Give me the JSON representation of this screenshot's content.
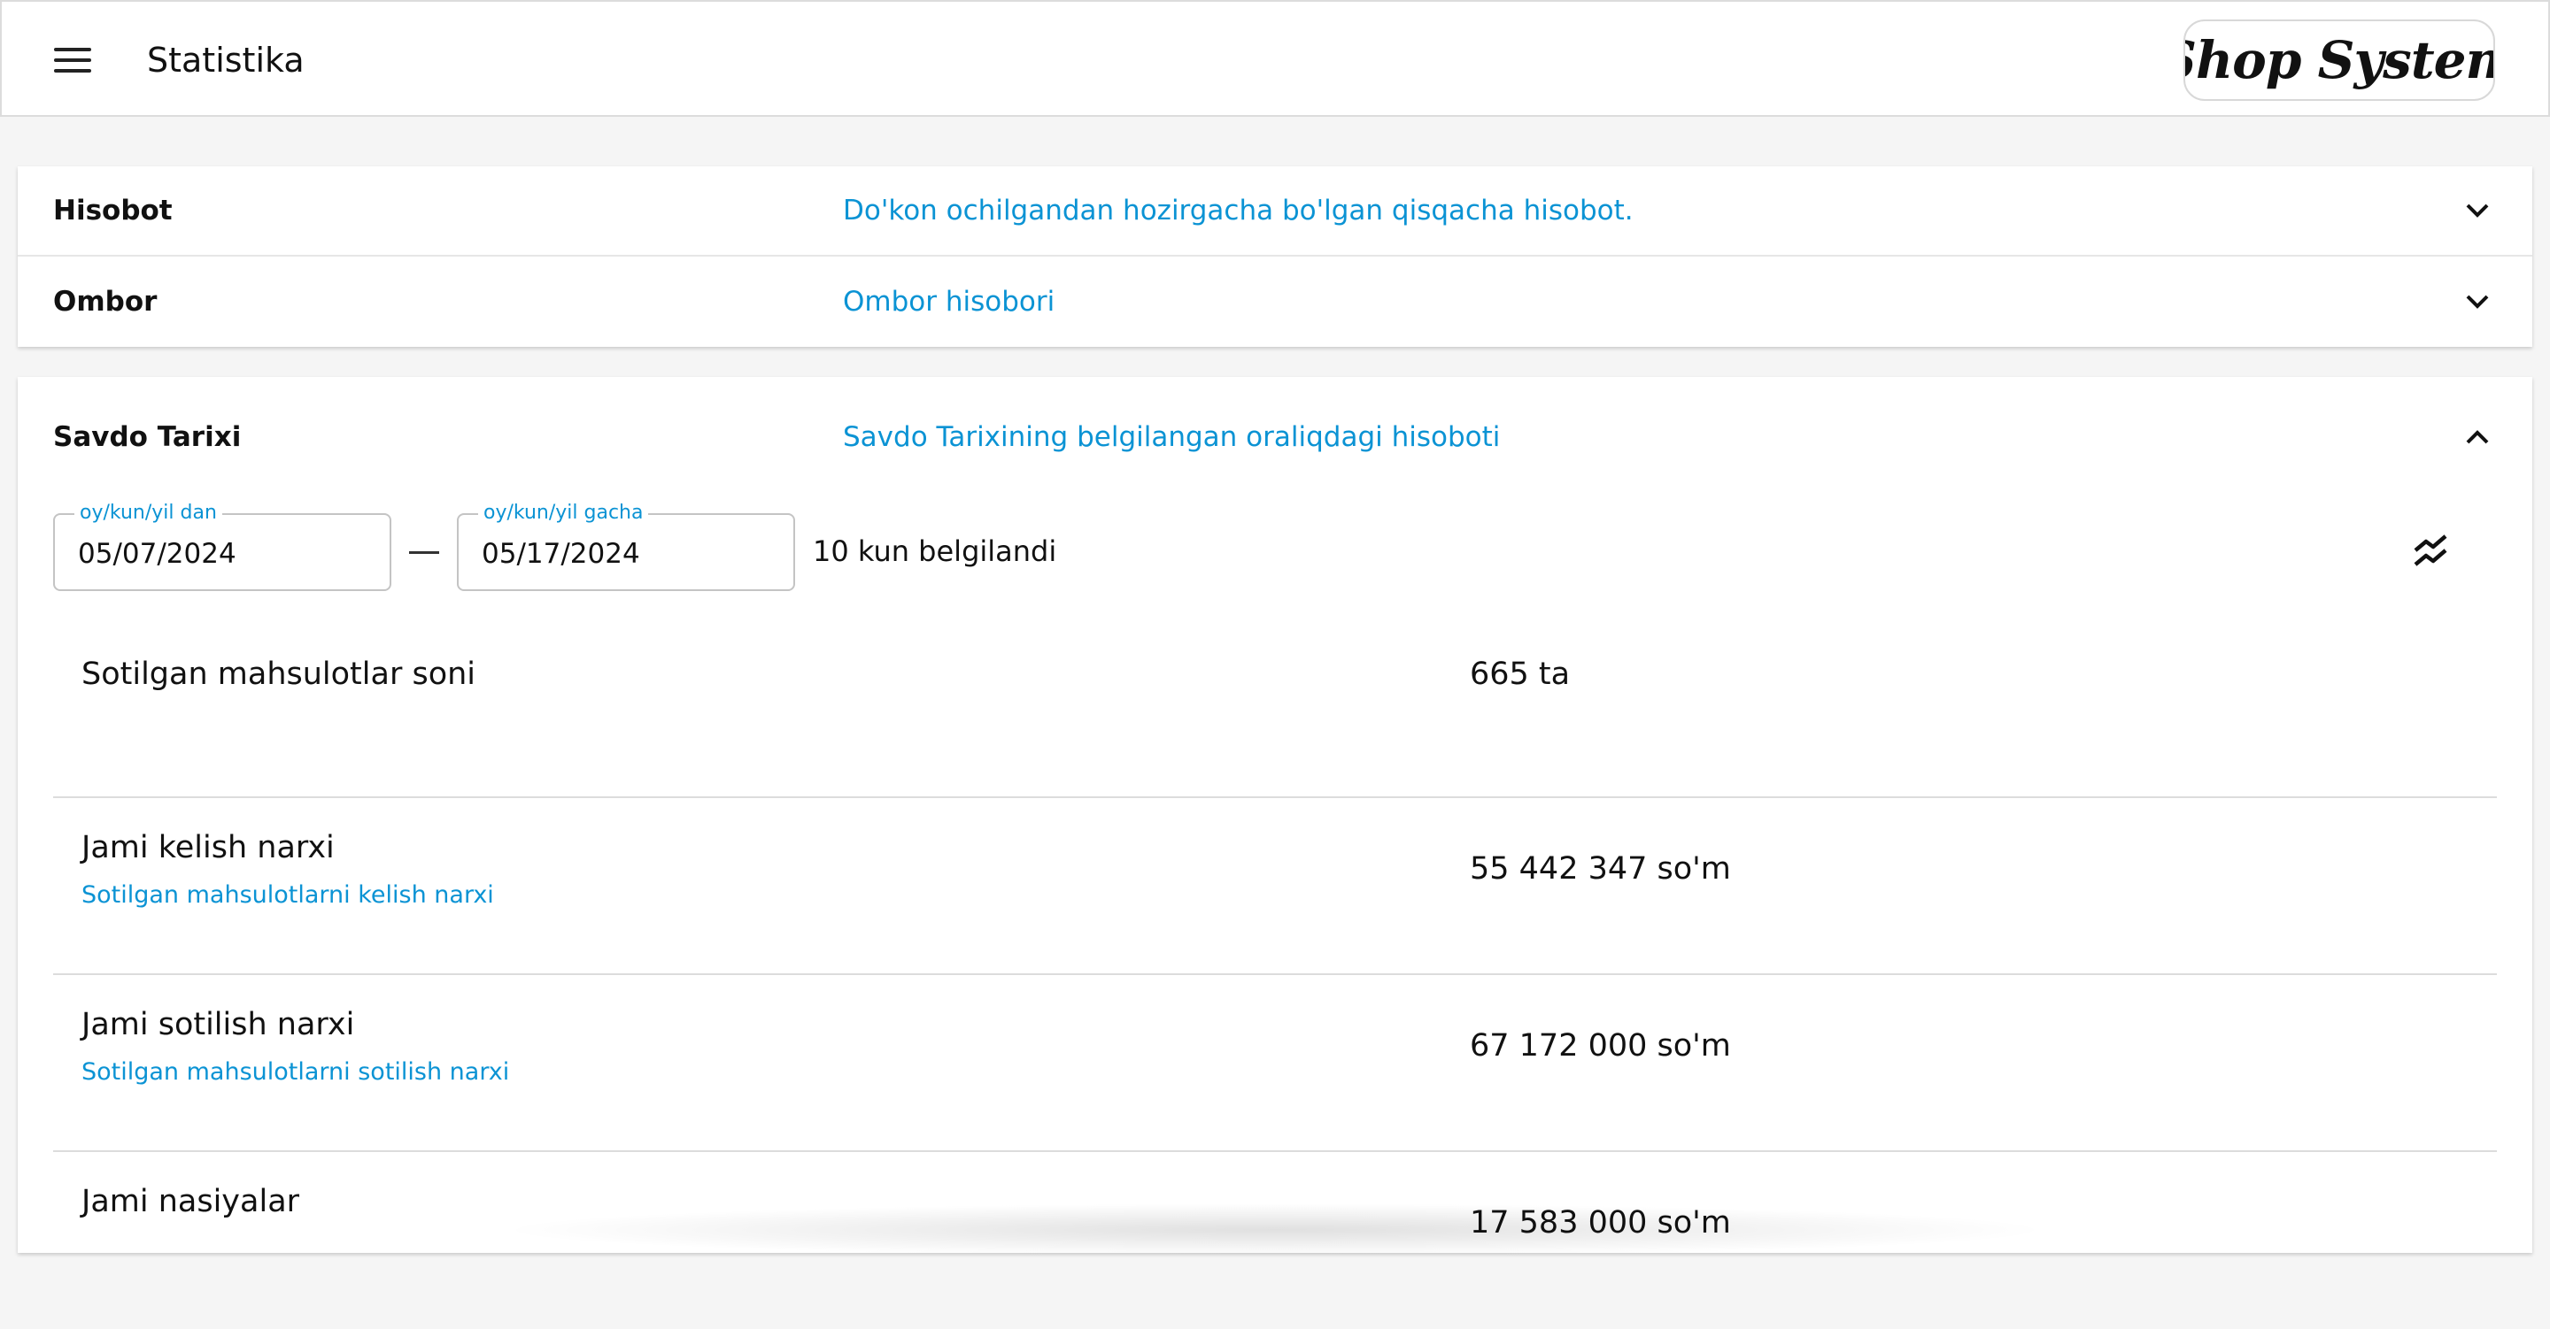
{
  "header": {
    "title": "Statistika",
    "logo_text": "Shop System"
  },
  "panels": [
    {
      "title": "Hisobot",
      "description": "Do'kon ochilgandan hozirgacha bo'lgan qisqacha hisobot."
    },
    {
      "title": "Ombor",
      "description": "Ombor hisobori"
    }
  ],
  "sales_history": {
    "title": "Savdo Tarixi",
    "description": "Savdo Tarixining belgilangan oraliqdagi hisoboti",
    "date_from": {
      "label": "oy/kun/yil dan",
      "value": "05/07/2024"
    },
    "date_to": {
      "label": "oy/kun/yil gacha",
      "value": "05/17/2024"
    },
    "range_note": "10 kun belgilandi",
    "stats": [
      {
        "label": "Sotilgan mahsulotlar soni",
        "sub": "",
        "value": "665 ta"
      },
      {
        "label": "Jami kelish narxi",
        "sub": "Sotilgan mahsulotlarni kelish narxi",
        "value": "55 442 347 so'm"
      },
      {
        "label": "Jami sotilish narxi",
        "sub": "Sotilgan mahsulotlarni sotilish narxi",
        "value": "67 172 000 so'm"
      },
      {
        "label": "Jami nasiyalar",
        "sub": "",
        "value": "17 583 000 so'm"
      }
    ]
  },
  "icons": {
    "menu": "menu-icon",
    "expand": "chevron-down-icon",
    "collapse": "chevron-up-icon",
    "stats_toggle": "trend-toggle-icon"
  },
  "colors": {
    "accent": "#0b93d4",
    "text": "#111111",
    "divider": "#dcdcdc"
  }
}
